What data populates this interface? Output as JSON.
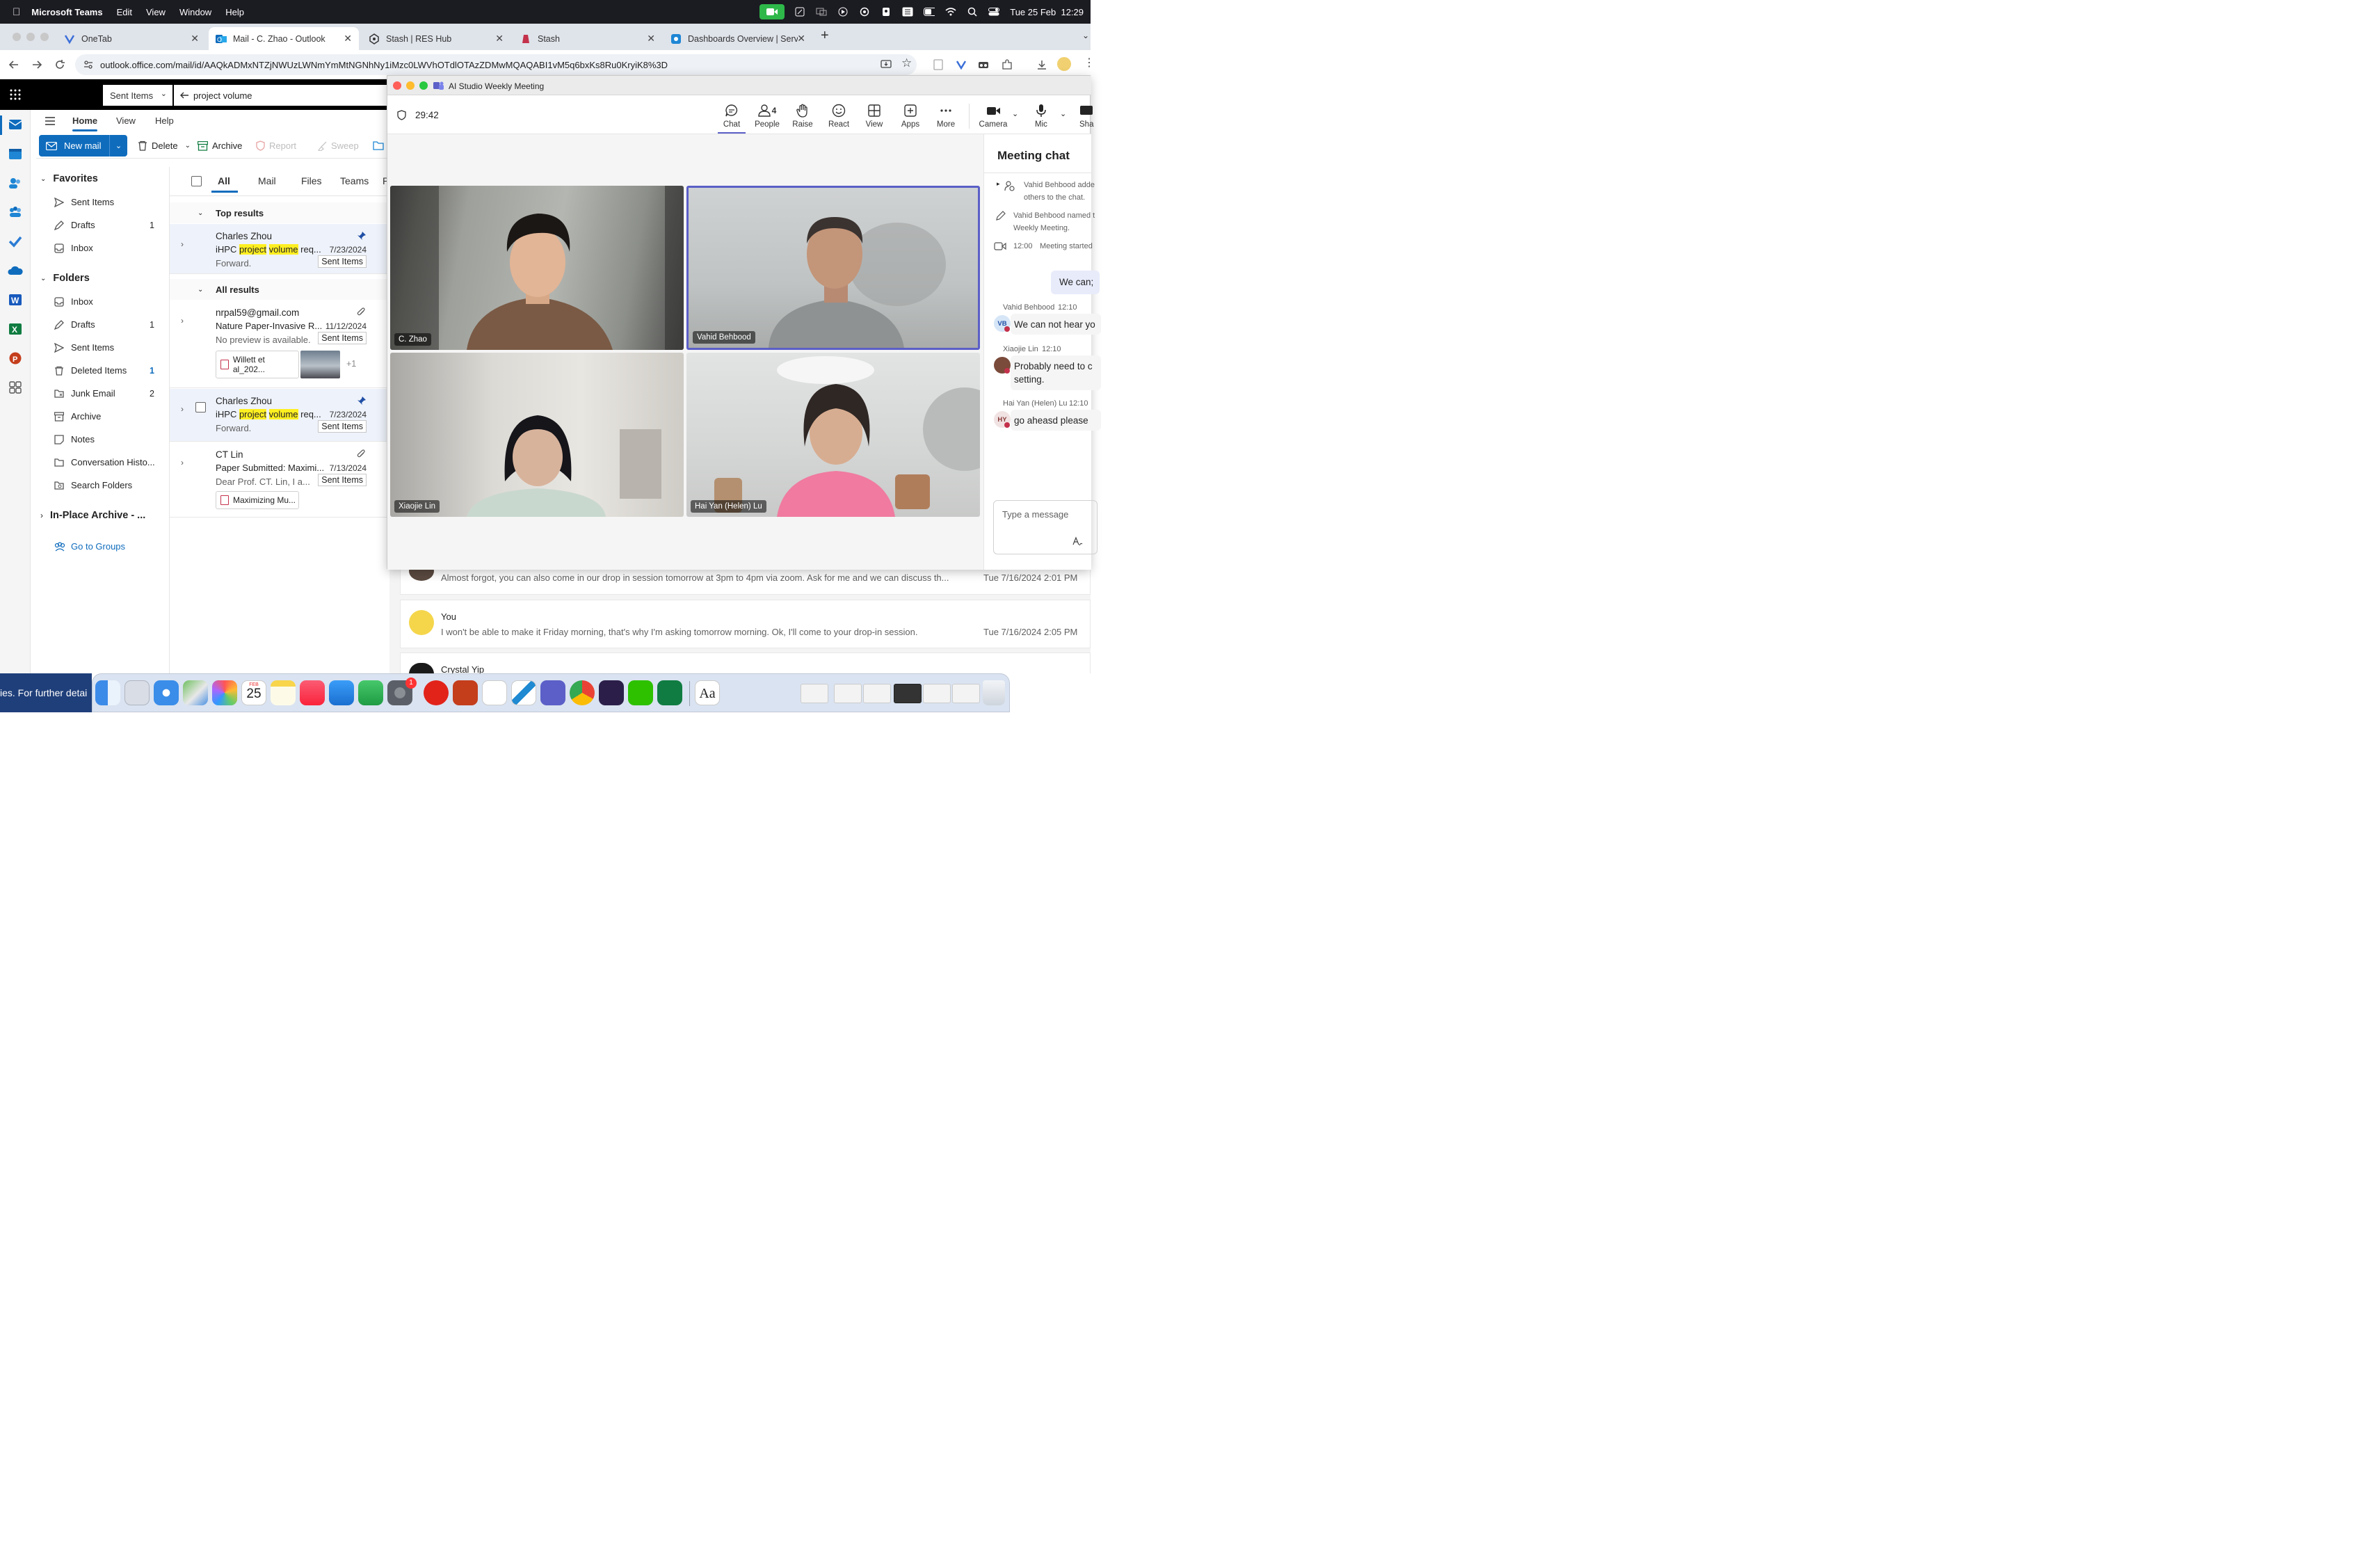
{
  "menubar": {
    "app": "Microsoft Teams",
    "items": [
      "Edit",
      "View",
      "Window",
      "Help"
    ],
    "datetime": "Tue 25 Feb  12:29"
  },
  "browser": {
    "tabs": [
      {
        "label": "OneTab"
      },
      {
        "label": "Mail - C. Zhao - Outlook"
      },
      {
        "label": "Stash | RES Hub"
      },
      {
        "label": "Stash"
      },
      {
        "label": "Dashboards Overview | Servic"
      }
    ],
    "url": "outlook.office.com/mail/id/AAQkADMxNTZjNWUzLWNmYmMtNGNhNy1iMzc0LWVhOTdlOTAzZDMwMQAQABI1vM5q6bxKs8Ru0KryiK8%3D"
  },
  "outlook": {
    "scope": "Sent Items",
    "query": "project volume",
    "ribbon_tabs": [
      "Home",
      "View",
      "Help"
    ],
    "new_mail": "New mail",
    "tools": {
      "delete": "Delete",
      "archive": "Archive",
      "report": "Report",
      "sweep": "Sweep"
    },
    "favorites": {
      "title": "Favorites",
      "items": [
        {
          "label": "Sent Items",
          "count": ""
        },
        {
          "label": "Drafts",
          "count": "1"
        },
        {
          "label": "Inbox",
          "count": ""
        }
      ]
    },
    "folders": {
      "title": "Folders",
      "items": [
        {
          "label": "Inbox",
          "count": ""
        },
        {
          "label": "Drafts",
          "count": "1"
        },
        {
          "label": "Sent Items",
          "count": ""
        },
        {
          "label": "Deleted Items",
          "count": "1"
        },
        {
          "label": "Junk Email",
          "count": "2"
        },
        {
          "label": "Archive",
          "count": ""
        },
        {
          "label": "Notes",
          "count": ""
        },
        {
          "label": "Conversation Histo...",
          "count": ""
        },
        {
          "label": "Search Folders",
          "count": ""
        }
      ]
    },
    "inplace": "In-Place Archive - ...",
    "groups": "Go to Groups",
    "list_tabs": [
      "All",
      "Mail",
      "Files",
      "Teams",
      "P"
    ],
    "top_results": "Top results",
    "all_results": "All results",
    "messages": [
      {
        "from": "Charles Zhou",
        "subj_a": "iHPC ",
        "subj_b": "project",
        "subj_c": " ",
        "subj_d": "volume",
        "subj_e": " req...",
        "date": "7/23/2024",
        "preview": "Forward.",
        "tag": "Sent Items"
      },
      {
        "from": "nrpal59@gmail.com",
        "subj": "Nature Paper-Invasive R...",
        "date": "11/12/2024",
        "preview": "No preview is available.",
        "tag": "Sent Items",
        "attachment": "Willett et al_202...",
        "more": "+1"
      },
      {
        "from": "Charles Zhou",
        "subj_a": "iHPC ",
        "subj_b": "project",
        "subj_c": " ",
        "subj_d": "volume",
        "subj_e": " req...",
        "date": "7/23/2024",
        "preview": "Forward.",
        "tag": "Sent Items"
      },
      {
        "from": "CT Lin",
        "subj": "Paper Submitted: Maximi...",
        "date": "7/13/2024",
        "preview": "Dear Prof. CT. Lin, I a...",
        "tag": "Sent Items",
        "attachment": "Maximizing Mu..."
      }
    ]
  },
  "reading": {
    "messages": [
      {
        "body": "Almost forgot, you can also come in our drop in session tomorrow at 3pm to 4pm via zoom. Ask for me and we can discuss th...",
        "time": "Tue 7/16/2024 2:01 PM"
      },
      {
        "sender": "You",
        "body": "I won't be able to make it Friday morning, that's why I'm asking tomorrow morning. Ok, I'll come to your drop-in session.",
        "time": "Tue 7/16/2024 2:05 PM"
      },
      {
        "sender": "Crystal Yip"
      }
    ]
  },
  "teams": {
    "title": "AI Studio Weekly Meeting",
    "timer": "29:42",
    "toolbar": {
      "chat": "Chat",
      "people": "People",
      "people_count": "4",
      "raise": "Raise",
      "react": "React",
      "view": "View",
      "apps": "Apps",
      "more": "More",
      "camera": "Camera",
      "mic": "Mic",
      "share": "Sha"
    },
    "participants": [
      {
        "name": "C. Zhao"
      },
      {
        "name": "Vahid Behbood"
      },
      {
        "name": "Xiaojie Lin"
      },
      {
        "name": "Hai Yan (Helen) Lu"
      }
    ],
    "chat": {
      "title": "Meeting chat",
      "events": [
        {
          "text1": "Vahid Behbood adde",
          "text2": "others to the chat."
        },
        {
          "text1": "Vahid Behbood named t",
          "text2": "Weekly Meeting."
        },
        {
          "time": "12:00",
          "text1": "Meeting started"
        }
      ],
      "mine": "We can;",
      "messages": [
        {
          "sender": "Vahid Behbood",
          "time": "12:10",
          "initials": "VB",
          "text": "We can not hear yo"
        },
        {
          "sender": "Xiaojie Lin",
          "time": "12:10",
          "text": "Probably need to c",
          "text2": "setting."
        },
        {
          "sender": "Hai Yan (Helen) Lu",
          "time": "12:10",
          "initials": "HY",
          "text": "go aheasd please"
        }
      ],
      "placeholder": "Type a message"
    }
  },
  "dock": {
    "calendar_month": "FEB",
    "calendar_day": "25",
    "badge": "1"
  },
  "bottom_text": "ies. For further detai",
  "colors": {
    "outlook_blue": "#0f6cbd",
    "teams_purple": "#5b5fc7",
    "highlight": "#ffef21"
  }
}
